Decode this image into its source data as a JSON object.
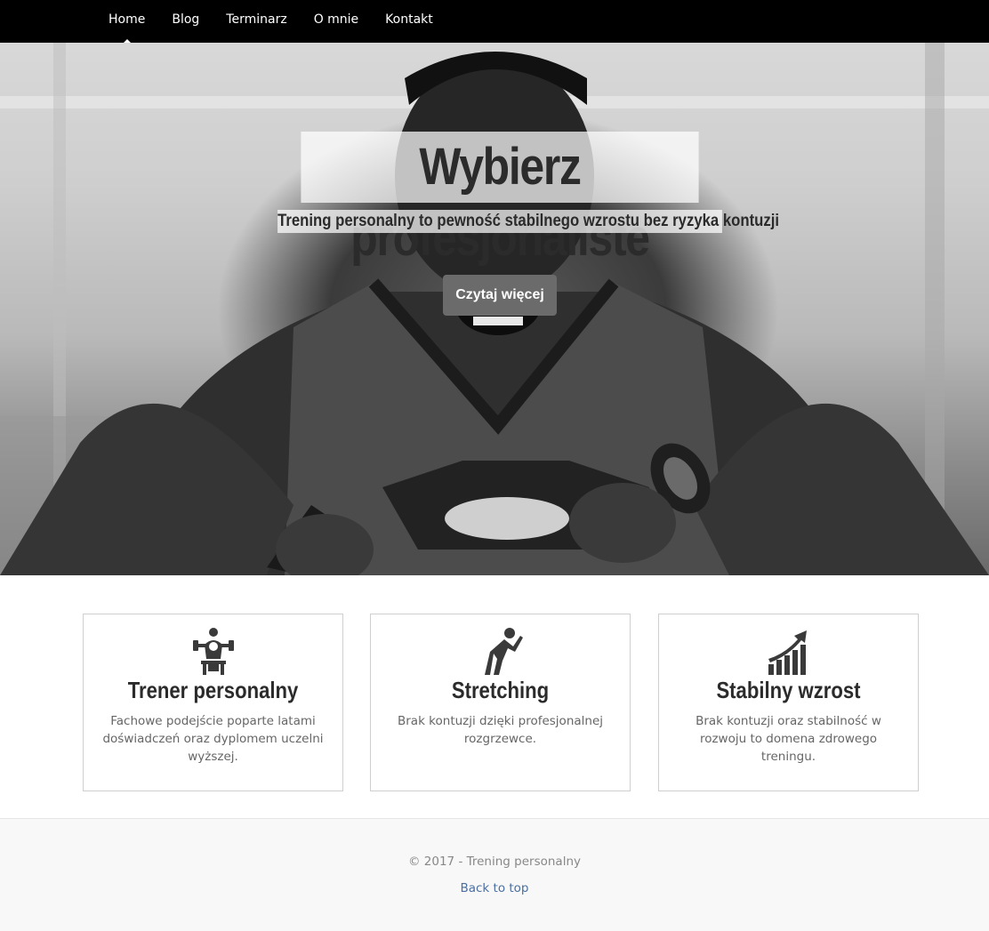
{
  "nav": {
    "items": [
      {
        "label": "Home",
        "active": true
      },
      {
        "label": "Blog"
      },
      {
        "label": "Terminarz"
      },
      {
        "label": "O mnie"
      },
      {
        "label": "Kontakt"
      }
    ]
  },
  "hero": {
    "title": "Wybierz profesjonaliste",
    "subtitle": "Trening personalny to pewność stabilnego wzrostu bez ryzyka kontuzji",
    "button_label": "Czytaj więcej"
  },
  "features": [
    {
      "icon": "trainer-icon",
      "title": "Trener personalny",
      "text": "Fachowe podejście poparte latami doświadczeń oraz dyplomem uczelni wyższej."
    },
    {
      "icon": "stretching-icon",
      "title": "Stretching",
      "text": "Brak kontuzji dzięki profesjonalnej rozgrzewce."
    },
    {
      "icon": "growth-chart-icon",
      "title": "Stabilny wzrost",
      "text": "Brak kontuzji oraz stabilność w rozwoju to domena zdrowego treningu."
    }
  ],
  "footer": {
    "copyright": "© 2017 - Trening personalny",
    "back_to_top": "Back to top"
  },
  "colors": {
    "nav_bg": "#000000",
    "icon_color": "#3a3a3a",
    "link": "#4a6fa0"
  }
}
